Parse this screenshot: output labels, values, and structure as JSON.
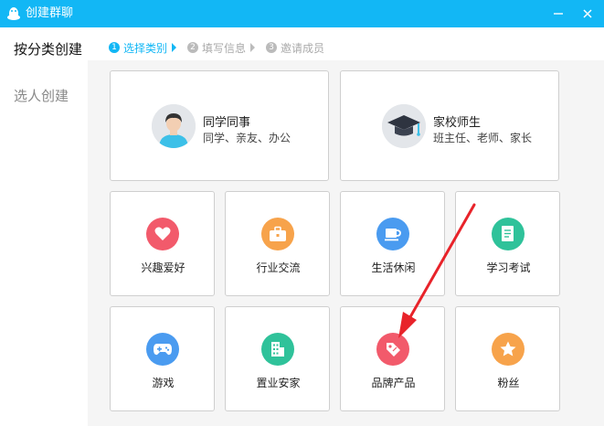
{
  "window": {
    "title": "创建群聊",
    "minimize_glyph": "—",
    "close_glyph": "✕"
  },
  "nav": {
    "by_category": "按分类创建",
    "by_people": "选人创建"
  },
  "steps": [
    {
      "num": "1",
      "label": "选择类别",
      "state": "active"
    },
    {
      "num": "2",
      "label": "填写信息",
      "state": "pending"
    },
    {
      "num": "3",
      "label": "邀请成员",
      "state": "pending"
    }
  ],
  "big_cards": [
    {
      "title": "同学同事",
      "subtitle": "同学、亲友、办公",
      "icon": "student-avatar-icon"
    },
    {
      "title": "家校师生",
      "subtitle": "班主任、老师、家长",
      "icon": "graduation-cap-icon"
    }
  ],
  "small_cards": [
    {
      "label": "兴趣爱好",
      "icon": "heart-icon",
      "color": "#f25a6b"
    },
    {
      "label": "行业交流",
      "icon": "briefcase-icon",
      "color": "#f7a34b"
    },
    {
      "label": "生活休闲",
      "icon": "coffee-cup-icon",
      "color": "#4a9bf0"
    },
    {
      "label": "学习考试",
      "icon": "notebook-icon",
      "color": "#2fc29a"
    },
    {
      "label": "游戏",
      "icon": "gamepad-icon",
      "color": "#4a9bf0"
    },
    {
      "label": "置业安家",
      "icon": "building-icon",
      "color": "#2fc29a"
    },
    {
      "label": "品牌产品",
      "icon": "price-tag-icon",
      "color": "#f25a6b"
    },
    {
      "label": "粉丝",
      "icon": "star-icon",
      "color": "#f7a34b"
    }
  ],
  "colors": {
    "titlebar": "#12b7f5",
    "active_step": "#12b7f5",
    "annotation_arrow": "#e8232a"
  }
}
